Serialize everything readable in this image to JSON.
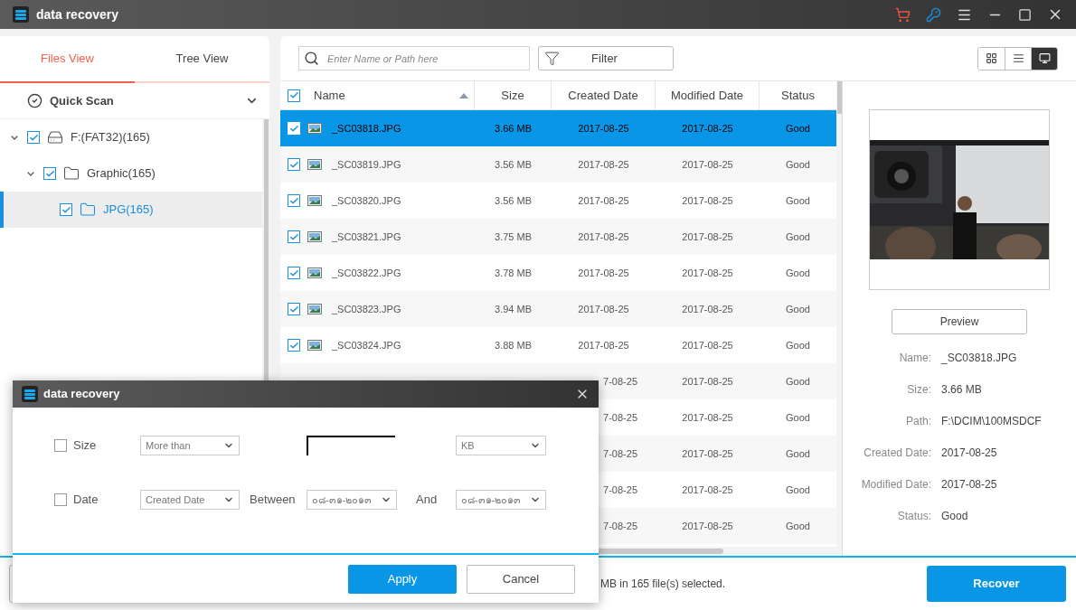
{
  "window": {
    "title": "data recovery"
  },
  "sidebar": {
    "tabs": [
      {
        "label": "Files View",
        "selected": true
      },
      {
        "label": "Tree View",
        "selected": false
      }
    ],
    "scan": {
      "label": "Quick Scan"
    },
    "tree": [
      {
        "label": "F:(FAT32)(165)",
        "kind": "drive",
        "checked": true,
        "selected": false,
        "children": [
          {
            "label": "Graphic(165)",
            "kind": "folder",
            "checked": true,
            "selected": false,
            "children": [
              {
                "label": "JPG(165)",
                "kind": "folder",
                "checked": true,
                "selected": true
              }
            ]
          }
        ]
      }
    ]
  },
  "search": {
    "placeholder": "Enter Name or Path here"
  },
  "filter_button": "Filter",
  "view_modes": [
    {
      "kind": "grid",
      "selected": false
    },
    {
      "kind": "list",
      "selected": false
    },
    {
      "kind": "preview",
      "selected": true
    }
  ],
  "table": {
    "all_checked": true,
    "columns": [
      "Name",
      "Size",
      "Created Date",
      "Modified Date",
      "Status"
    ],
    "rows": [
      {
        "checked": true,
        "selected": true,
        "name": "_SC03818.JPG",
        "size": "3.66 MB",
        "created": "2017-08-25",
        "modified": "2017-08-25",
        "status": "Good"
      },
      {
        "checked": true,
        "selected": false,
        "name": "_SC03819.JPG",
        "size": "3.56 MB",
        "created": "2017-08-25",
        "modified": "2017-08-25",
        "status": "Good"
      },
      {
        "checked": true,
        "selected": false,
        "name": "_SC03820.JPG",
        "size": "3.56 MB",
        "created": "2017-08-25",
        "modified": "2017-08-25",
        "status": "Good"
      },
      {
        "checked": true,
        "selected": false,
        "name": "_SC03821.JPG",
        "size": "3.75 MB",
        "created": "2017-08-25",
        "modified": "2017-08-25",
        "status": "Good"
      },
      {
        "checked": true,
        "selected": false,
        "name": "_SC03822.JPG",
        "size": "3.78 MB",
        "created": "2017-08-25",
        "modified": "2017-08-25",
        "status": "Good"
      },
      {
        "checked": true,
        "selected": false,
        "name": "_SC03823.JPG",
        "size": "3.94 MB",
        "created": "2017-08-25",
        "modified": "2017-08-25",
        "status": "Good"
      },
      {
        "checked": true,
        "selected": false,
        "name": "_SC03824.JPG",
        "size": "3.88 MB",
        "created": "2017-08-25",
        "modified": "2017-08-25",
        "status": "Good"
      },
      {
        "selected": false,
        "created": "7-08-25",
        "modified": "2017-08-25",
        "status": "Good"
      },
      {
        "selected": false,
        "created": "7-08-25",
        "modified": "2017-08-25",
        "status": "Good"
      },
      {
        "selected": false,
        "created": "7-08-25",
        "modified": "2017-08-25",
        "status": "Good"
      },
      {
        "selected": false,
        "created": "7-08-25",
        "modified": "2017-08-25",
        "status": "Good"
      },
      {
        "selected": false,
        "created": "7-08-25",
        "modified": "2017-08-25",
        "status": "Good"
      }
    ]
  },
  "preview": {
    "button": "Preview",
    "details": [
      {
        "label": "Name:",
        "value": "_SC03818.JPG"
      },
      {
        "label": "Size:",
        "value": "3.66 MB"
      },
      {
        "label": "Path:",
        "value": "F:\\DCIM\\100MSDCF"
      },
      {
        "label": "Created Date:",
        "value": "2017-08-25"
      },
      {
        "label": "Modified Date:",
        "value": "2017-08-25"
      },
      {
        "label": "Status:",
        "value": "Good"
      }
    ]
  },
  "status_bar": {
    "text": "MB in 165 file(s) selected.",
    "button": "Recover"
  },
  "dialog": {
    "title": "data recovery",
    "size_row": {
      "checked": false,
      "label": "Size",
      "comparison": "More than",
      "unit": "KB"
    },
    "date_row": {
      "checked": false,
      "label": "Date",
      "field": "Created Date",
      "between": "Between",
      "from": "๐๘-๓๑-๒๐๑๓",
      "and": "And",
      "to": "๐๘-๓๑-๒๐๑๓"
    },
    "buttons": [
      "Apply",
      "Cancel"
    ]
  }
}
